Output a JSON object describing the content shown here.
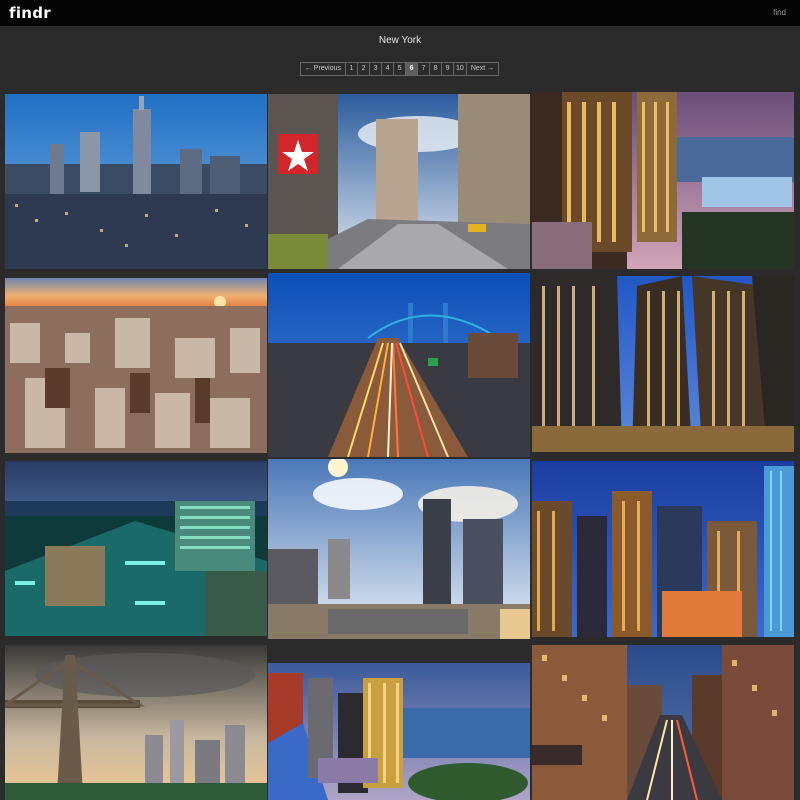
{
  "topbar": {
    "brand": "findr",
    "find_label": "find"
  },
  "heading": "New York",
  "pagination": {
    "previous_label": "← Previous",
    "next_label": "Next →",
    "pages": [
      "1",
      "2",
      "3",
      "4",
      "5",
      "6",
      "7",
      "8",
      "9",
      "10"
    ],
    "current": "6"
  },
  "photos": [
    {
      "subject": "Midtown skyline at dusk with Empire State Building"
    },
    {
      "subject": "Times Square street with red star sign"
    },
    {
      "subject": "Lit skyscrapers by the Hudson river at night"
    },
    {
      "subject": "Manhattan rooftops at sunset"
    },
    {
      "subject": "Highway light trails at twilight with bridge"
    },
    {
      "subject": "Looking up at glass towers at night"
    },
    {
      "subject": "Waterfront buildings at night in teal light"
    },
    {
      "subject": "Construction site with towers under clouds"
    },
    {
      "subject": "Night city towers with blue spire"
    },
    {
      "subject": "Queensboro bridge with skyline at dusk"
    },
    {
      "subject": "Towers by the water at twilight"
    },
    {
      "subject": "Street canyon with car light trails"
    }
  ]
}
